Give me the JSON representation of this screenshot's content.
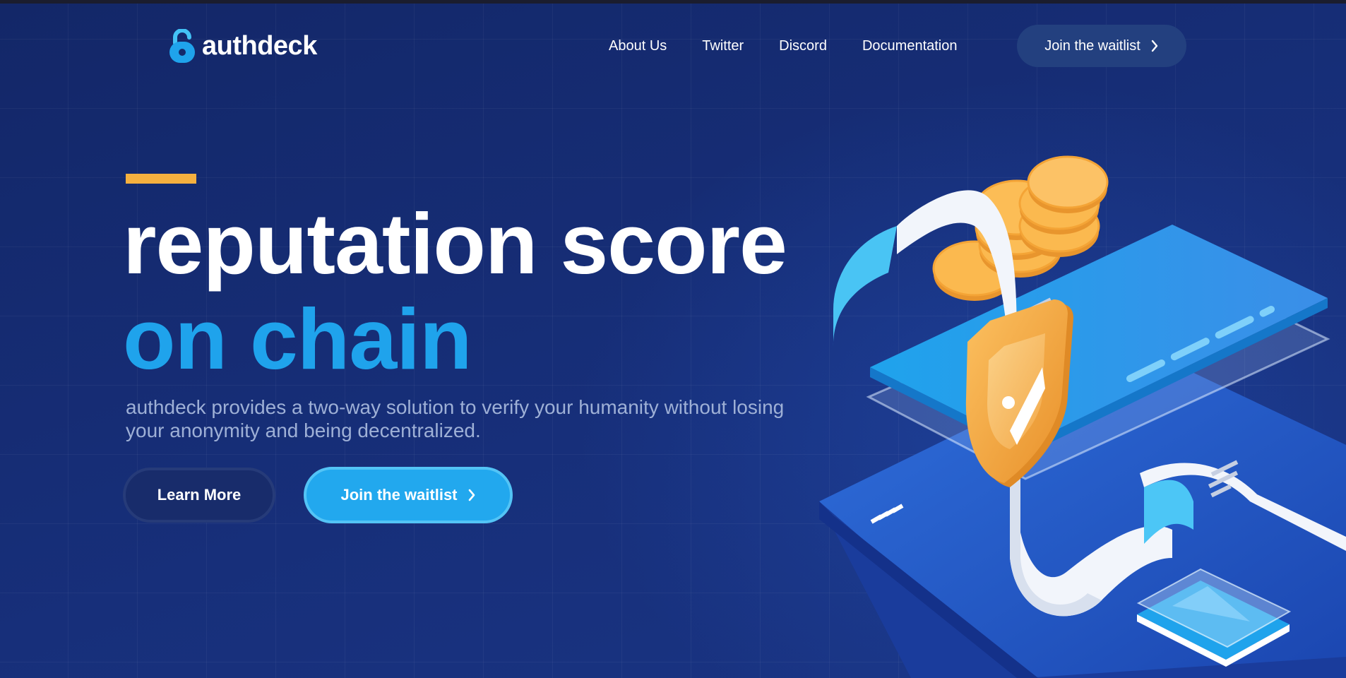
{
  "brand": {
    "name": "authdeck"
  },
  "nav": {
    "items": [
      {
        "label": "About Us"
      },
      {
        "label": "Twitter"
      },
      {
        "label": "Discord"
      },
      {
        "label": "Documentation"
      }
    ],
    "cta_label": "Join the waitlist",
    "cta_icon": "chevron-right-icon"
  },
  "hero": {
    "title_line1": "reputation score",
    "title_line2": "on chain",
    "description": "authdeck provides a two-way solution to verify your humanity without losing your anonymity and being decentralized.",
    "learn_more_label": "Learn More",
    "join_label": "Join the waitlist"
  },
  "colors": {
    "background": "#14296a",
    "accent_bar": "#f5b03f",
    "title_highlight": "#1fa3ec",
    "primary_button": "#22a8ee"
  }
}
